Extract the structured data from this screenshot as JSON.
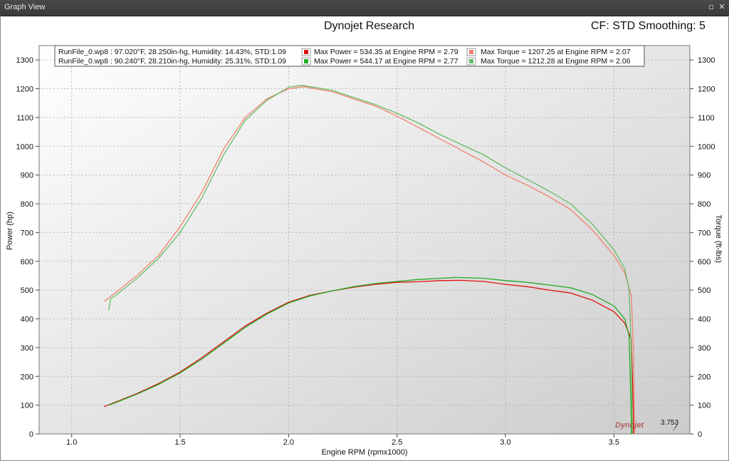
{
  "window": {
    "title": "Graph View",
    "restore_glyph": "▫",
    "close_glyph": "✕"
  },
  "header": {
    "title": "Dynojet Research",
    "correction": "CF: STD Smoothing: 5"
  },
  "legend": {
    "runs": [
      {
        "info": "RunFile_0.wp8 : 97.020°F, 28.250in-hg, Humidity: 14.43%, STD:1.09",
        "max_power": "Max Power = 534.35 at Engine RPM = 2.79",
        "max_torque": "Max Torque = 1207.25 at Engine RPM = 2.07",
        "power_color": "#dd1111",
        "torque_color": "#f08070"
      },
      {
        "info": "RunFile_0.wp8 : 90.240°F, 28.210in-hg, Humidity: 25.31%, STD:1.09",
        "max_power": "Max Power = 544.17 at Engine RPM = 2.77",
        "max_torque": "Max Torque = 1212.28 at Engine RPM = 2.06",
        "power_color": "#22aa22",
        "torque_color": "#66bb66"
      }
    ]
  },
  "cursor_value": "3.753",
  "watermark": "Dynojet",
  "chart_data": {
    "type": "line",
    "title": "Dynojet Research",
    "xlabel": "Engine RPM (rpmx1000)",
    "ylabel": "Power (hp)",
    "y2label": "Torque (ft-lbs)",
    "xlim": [
      0.85,
      3.85
    ],
    "ylim": [
      0,
      1350
    ],
    "xticks": [
      "1.0",
      "1.5",
      "2.0",
      "2.5",
      "3.0",
      "3.5"
    ],
    "yticks": [
      "0",
      "100",
      "200",
      "300",
      "400",
      "500",
      "600",
      "700",
      "800",
      "900",
      "1000",
      "1100",
      "1200",
      "1300"
    ],
    "grid": true,
    "series": [
      {
        "name": "Max Power = 534.35 at Engine RPM = 2.79",
        "kind": "power",
        "color": "#dd1111",
        "points": [
          [
            1.15,
            95
          ],
          [
            1.2,
            110
          ],
          [
            1.3,
            140
          ],
          [
            1.4,
            175
          ],
          [
            1.5,
            215
          ],
          [
            1.6,
            265
          ],
          [
            1.7,
            320
          ],
          [
            1.8,
            375
          ],
          [
            1.9,
            420
          ],
          [
            2.0,
            458
          ],
          [
            2.1,
            482
          ],
          [
            2.2,
            497
          ],
          [
            2.3,
            510
          ],
          [
            2.4,
            520
          ],
          [
            2.5,
            527
          ],
          [
            2.6,
            529
          ],
          [
            2.7,
            533
          ],
          [
            2.79,
            534
          ],
          [
            2.9,
            530
          ],
          [
            3.0,
            520
          ],
          [
            3.1,
            512
          ],
          [
            3.2,
            500
          ],
          [
            3.3,
            490
          ],
          [
            3.4,
            465
          ],
          [
            3.5,
            425
          ],
          [
            3.55,
            385
          ],
          [
            3.58,
            330
          ],
          [
            3.585,
            200
          ],
          [
            3.59,
            60
          ],
          [
            3.59,
            0
          ]
        ]
      },
      {
        "name": "Max Power = 544.17 at Engine RPM = 2.77",
        "kind": "power",
        "color": "#22aa22",
        "points": [
          [
            1.17,
            100
          ],
          [
            1.2,
            108
          ],
          [
            1.3,
            138
          ],
          [
            1.4,
            172
          ],
          [
            1.5,
            212
          ],
          [
            1.6,
            260
          ],
          [
            1.7,
            315
          ],
          [
            1.8,
            370
          ],
          [
            1.9,
            417
          ],
          [
            2.0,
            455
          ],
          [
            2.1,
            480
          ],
          [
            2.2,
            497
          ],
          [
            2.3,
            512
          ],
          [
            2.4,
            523
          ],
          [
            2.5,
            530
          ],
          [
            2.6,
            537
          ],
          [
            2.7,
            541
          ],
          [
            2.77,
            544
          ],
          [
            2.9,
            541
          ],
          [
            3.0,
            533
          ],
          [
            3.1,
            527
          ],
          [
            3.2,
            518
          ],
          [
            3.3,
            508
          ],
          [
            3.4,
            485
          ],
          [
            3.5,
            445
          ],
          [
            3.55,
            400
          ],
          [
            3.57,
            340
          ],
          [
            3.575,
            200
          ],
          [
            3.58,
            60
          ],
          [
            3.58,
            0
          ]
        ]
      },
      {
        "name": "Max Torque = 1207.25 at Engine RPM = 2.07",
        "kind": "torque",
        "color": "#f08070",
        "points": [
          [
            1.15,
            460
          ],
          [
            1.2,
            490
          ],
          [
            1.3,
            550
          ],
          [
            1.4,
            620
          ],
          [
            1.5,
            720
          ],
          [
            1.6,
            840
          ],
          [
            1.7,
            990
          ],
          [
            1.8,
            1100
          ],
          [
            1.9,
            1165
          ],
          [
            2.0,
            1200
          ],
          [
            2.07,
            1207
          ],
          [
            2.2,
            1190
          ],
          [
            2.3,
            1165
          ],
          [
            2.4,
            1140
          ],
          [
            2.5,
            1105
          ],
          [
            2.6,
            1065
          ],
          [
            2.7,
            1025
          ],
          [
            2.8,
            985
          ],
          [
            2.9,
            945
          ],
          [
            3.0,
            900
          ],
          [
            3.1,
            865
          ],
          [
            3.2,
            825
          ],
          [
            3.3,
            780
          ],
          [
            3.4,
            710
          ],
          [
            3.5,
            620
          ],
          [
            3.55,
            560
          ],
          [
            3.58,
            480
          ],
          [
            3.59,
            300
          ],
          [
            3.595,
            0
          ]
        ]
      },
      {
        "name": "Max Torque = 1212.28 at Engine RPM = 2.06",
        "kind": "torque",
        "color": "#66bb66",
        "points": [
          [
            1.17,
            430
          ],
          [
            1.18,
            470
          ],
          [
            1.2,
            480
          ],
          [
            1.3,
            540
          ],
          [
            1.4,
            610
          ],
          [
            1.5,
            700
          ],
          [
            1.6,
            820
          ],
          [
            1.7,
            970
          ],
          [
            1.8,
            1090
          ],
          [
            1.9,
            1160
          ],
          [
            2.0,
            1205
          ],
          [
            2.06,
            1212
          ],
          [
            2.2,
            1195
          ],
          [
            2.3,
            1170
          ],
          [
            2.4,
            1145
          ],
          [
            2.5,
            1115
          ],
          [
            2.6,
            1080
          ],
          [
            2.7,
            1040
          ],
          [
            2.8,
            1005
          ],
          [
            2.9,
            970
          ],
          [
            3.0,
            925
          ],
          [
            3.1,
            885
          ],
          [
            3.2,
            845
          ],
          [
            3.3,
            800
          ],
          [
            3.4,
            730
          ],
          [
            3.5,
            640
          ],
          [
            3.55,
            575
          ],
          [
            3.57,
            500
          ],
          [
            3.58,
            300
          ],
          [
            3.585,
            0
          ]
        ]
      }
    ]
  }
}
